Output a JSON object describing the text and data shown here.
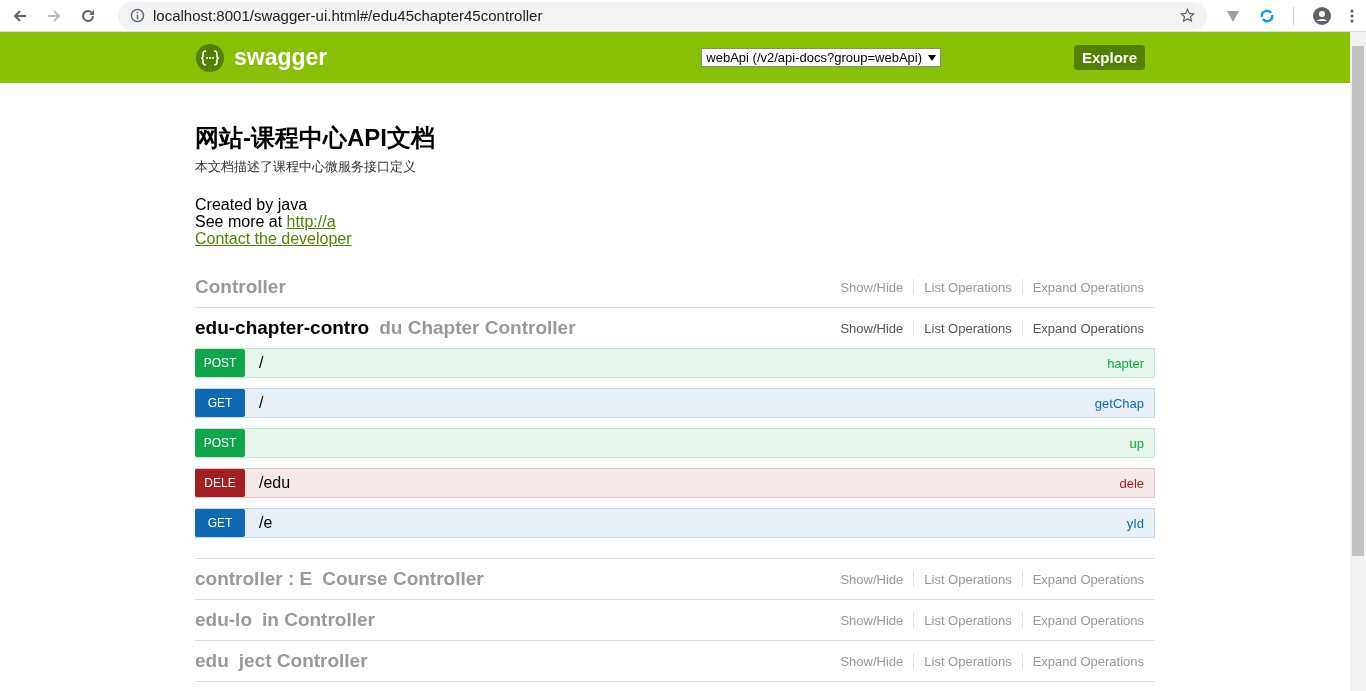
{
  "browser": {
    "url": "localhost:8001/swagger-ui.html#/edu45chapter45controller"
  },
  "header": {
    "logo": "swagger",
    "api_select": "webApi (/v2/api-docs?group=webApi)",
    "explore": "Explore"
  },
  "info": {
    "title": "网站-课程中心API文档",
    "description": "本文档描述了课程中心微服务接口定义",
    "created": "Created by java",
    "see_more": "See more at",
    "see_more_link": "http://a",
    "contact": "Contact the developer"
  },
  "groups": [
    {
      "description": "Controller",
      "expanded": false,
      "actions": [
        "Show/Hide",
        "List Operations",
        "Expand Operations"
      ]
    },
    {
      "name": "edu-chapter-contro",
      "description": "du Chapter Controller",
      "expanded": true,
      "actions": [
        "Show/Hide",
        "List Operations",
        "Expand Operations"
      ],
      "operations": [
        {
          "kind": "post",
          "method": "POST",
          "path": "/",
          "summary": "hapter"
        },
        {
          "kind": "get",
          "method": "GET",
          "path": "/",
          "summary": "getChap"
        },
        {
          "kind": "post",
          "method": "POST",
          "summary": "up"
        },
        {
          "kind": "delete",
          "method": "DELE",
          "path": "/edu",
          "summary": "dele"
        },
        {
          "kind": "get",
          "method": "GET",
          "path": "/e",
          "summary": "yId"
        }
      ]
    },
    {
      "name": "controller : E",
      "description": "Course Controller",
      "expanded": false,
      "actions": [
        "Show/Hide",
        "List Operations",
        "Expand Operations"
      ]
    },
    {
      "name": "edu-lo",
      "description": "in Controller",
      "expanded": false,
      "actions": [
        "Show/Hide",
        "List Operations",
        "Expand Operations"
      ]
    },
    {
      "name": "edu",
      "description": "ject Controller",
      "expanded": false,
      "actions": [
        "Show/Hide",
        "List Operations",
        "Expand Operations"
      ]
    }
  ]
}
